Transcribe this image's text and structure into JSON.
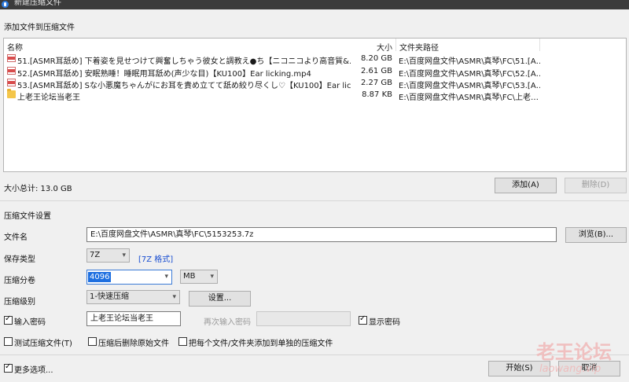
{
  "window": {
    "title": "新建压缩文件"
  },
  "add_section": {
    "title": "添加文件到压缩文件"
  },
  "file_list": {
    "columns": {
      "name": "名称",
      "size": "大小",
      "path": "文件夹路径"
    },
    "rows": [
      {
        "icon": "video-file-icon",
        "name": "51.[ASMR耳舐め] 下着姿を見せつけて興奮しちゃう彼女と調教え●ち【ニコニコより高音質&…",
        "size": "8.20 GB",
        "path": "E:\\百度网盘文件\\ASMR\\真琴\\FC\\51.[A…"
      },
      {
        "icon": "video-file-icon",
        "name": "52.[ASMR耳舐め] 安眠熟睡！睡眠用耳舐め(声少な目)【KU100】Ear licking.mp4",
        "size": "2.61 GB",
        "path": "E:\\百度网盘文件\\ASMR\\真琴\\FC\\52.[A…"
      },
      {
        "icon": "video-file-icon",
        "name": "53.[ASMR耳舐め] Sな小悪魔ちゃんがにお耳を責め立てて舐め絞り尽くし♡【KU100】Ear licki…",
        "size": "2.27 GB",
        "path": "E:\\百度网盘文件\\ASMR\\真琴\\FC\\53.[A…"
      },
      {
        "icon": "folder-icon",
        "name": "上老王论坛当老王",
        "size": "8.87 KB",
        "path": "E:\\百度网盘文件\\ASMR\\真琴\\FC\\上老…"
      }
    ]
  },
  "total_size": "大小总计: 13.0 GB",
  "buttons": {
    "add": "添加(A)",
    "delete": "删除(D)",
    "browse": "浏览(B)...",
    "settings": "设置...",
    "start": "开始(S)",
    "cancel": "取消"
  },
  "settings_section": {
    "title": "压缩文件设置"
  },
  "fields": {
    "filename_label": "文件名",
    "filename_value": "E:\\百度网盘文件\\ASMR\\真琴\\FC\\5153253.7z",
    "type_label": "保存类型",
    "type_value": "7Z",
    "type_link": "[7Z 格式]",
    "split_label": "压缩分卷",
    "split_value": "4096",
    "split_unit": "MB",
    "level_label": "压缩级别",
    "level_value": "1-快速压缩",
    "password_label": "输入密码",
    "password_value": "上老王论坛当老王",
    "password_confirm_label": "再次输入密码",
    "show_password_label": "显示密码",
    "test_label": "测试压缩文件(T)",
    "delete_source_label": "压缩后删除原始文件",
    "separate_label": "把每个文件/文件夹添加到单独的压缩文件",
    "more_options_label": "更多选项..."
  },
  "checkboxes": {
    "password": true,
    "show_password": true,
    "test": false,
    "delete_source": false,
    "separate": false,
    "more_options": true
  },
  "watermark": {
    "cn": "老王论坛",
    "en": "laowang.vip"
  }
}
